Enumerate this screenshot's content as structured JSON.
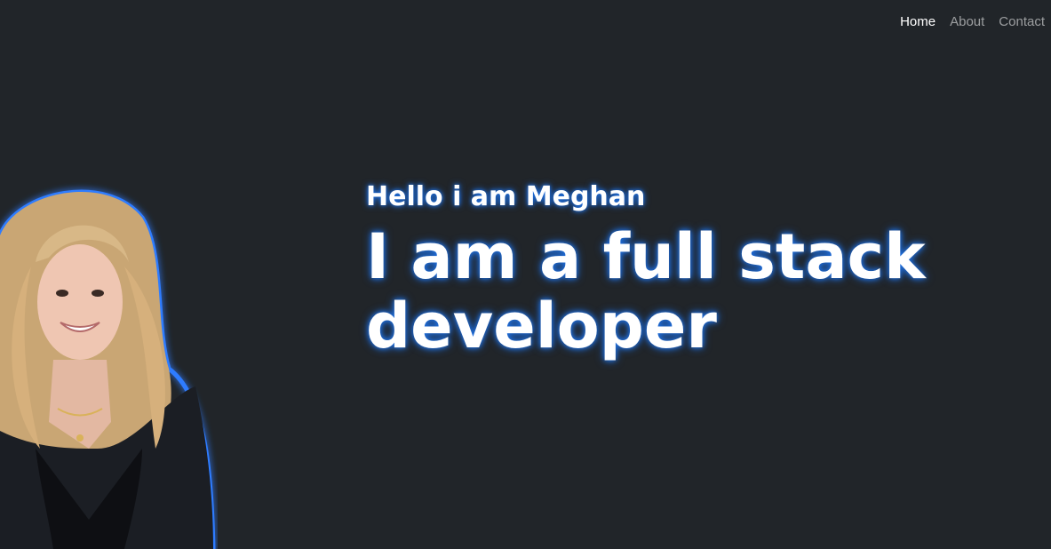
{
  "nav": {
    "items": [
      {
        "label": "Home",
        "active": true
      },
      {
        "label": "About",
        "active": false
      },
      {
        "label": "Contact",
        "active": false
      }
    ]
  },
  "hero": {
    "greeting": "Hello i am Meghan",
    "title": "I am a full stack developer"
  },
  "colors": {
    "background": "#212529",
    "glow": "#1f6fe0",
    "text": "#ffffff",
    "nav_inactive": "rgba(255,255,255,0.55)"
  },
  "portrait": {
    "icon": "person-portrait-photo"
  }
}
